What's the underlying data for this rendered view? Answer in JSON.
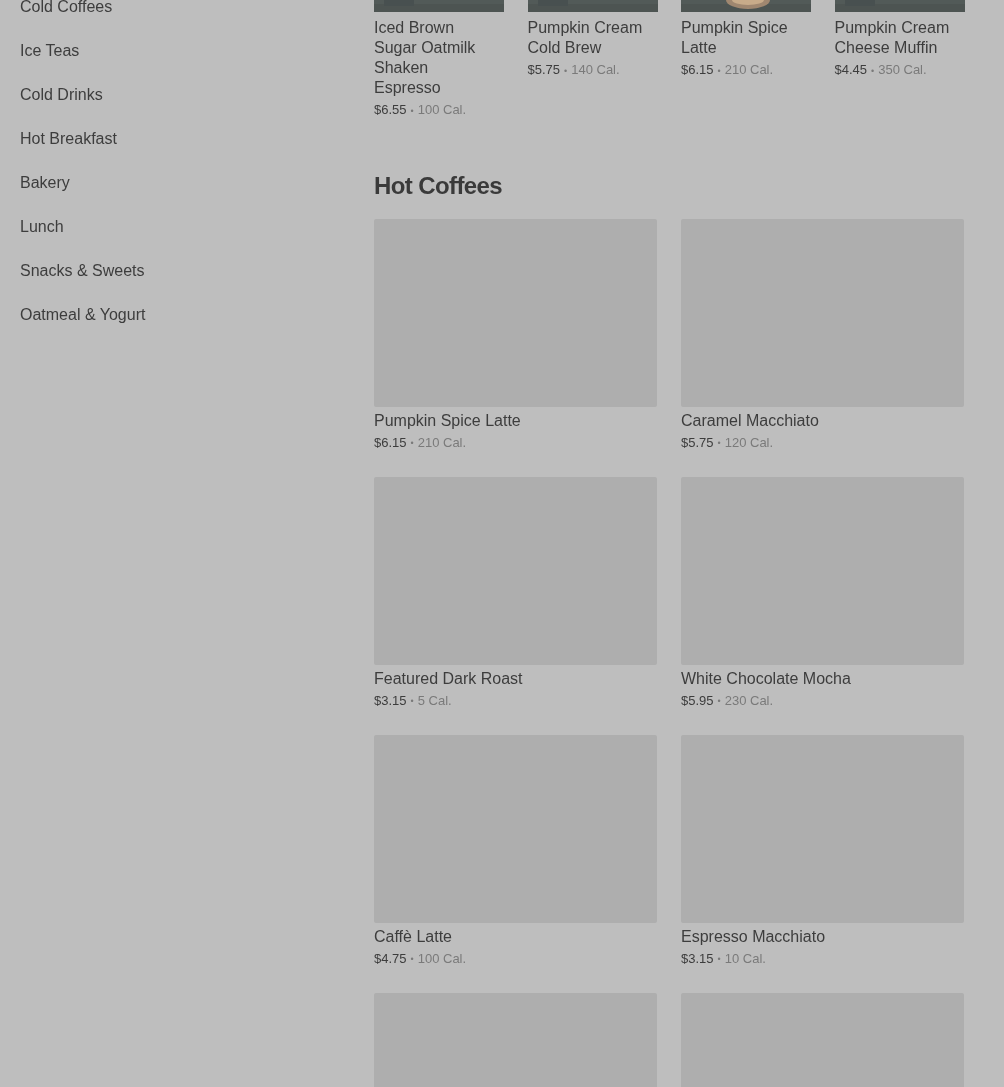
{
  "sidebar": {
    "items": [
      {
        "label": "Cold Coffees"
      },
      {
        "label": "Ice Teas"
      },
      {
        "label": "Cold Drinks"
      },
      {
        "label": "Hot Breakfast"
      },
      {
        "label": "Bakery"
      },
      {
        "label": "Lunch"
      },
      {
        "label": "Snacks & Sweets"
      },
      {
        "label": "Oatmeal & Yogurt"
      }
    ]
  },
  "featured": [
    {
      "name": "Iced Brown Sugar Oatmilk Shaken Espresso",
      "price": "$6.55",
      "separator": "•",
      "calories": "100 Cal."
    },
    {
      "name": "Pumpkin Cream Cold Brew",
      "price": "$5.75",
      "separator": "•",
      "calories": "140 Cal."
    },
    {
      "name": "Pumpkin Spice Latte",
      "price": "$6.15",
      "separator": "•",
      "calories": "210 Cal."
    },
    {
      "name": "Pumpkin Cream Cheese Muffin",
      "price": "$4.45",
      "separator": "•",
      "calories": "350 Cal."
    }
  ],
  "section": {
    "title": "Hot Coffees",
    "products": [
      {
        "kind": "item",
        "name": "Pumpkin Spice Latte",
        "price": "$6.15",
        "separator": "•",
        "calories": "210 Cal."
      },
      {
        "kind": "item",
        "name": "Caramel Macchiato",
        "price": "$5.75",
        "separator": "•",
        "calories": "120 Cal."
      },
      {
        "kind": "item",
        "name": "Featured Dark Roast",
        "price": "$3.15",
        "separator": "•",
        "calories": "5 Cal."
      },
      {
        "kind": "item",
        "name": "White Chocolate Mocha",
        "price": "$5.95",
        "separator": "•",
        "calories": "230 Cal."
      },
      {
        "kind": "item",
        "name": "Caffè Latte",
        "price": "$4.75",
        "separator": "•",
        "calories": "100 Cal."
      },
      {
        "kind": "item",
        "name": "Espresso Macchiato",
        "price": "$3.15",
        "separator": "•",
        "calories": "10 Cal."
      },
      {
        "kind": "tile"
      },
      {
        "kind": "tile"
      }
    ]
  }
}
